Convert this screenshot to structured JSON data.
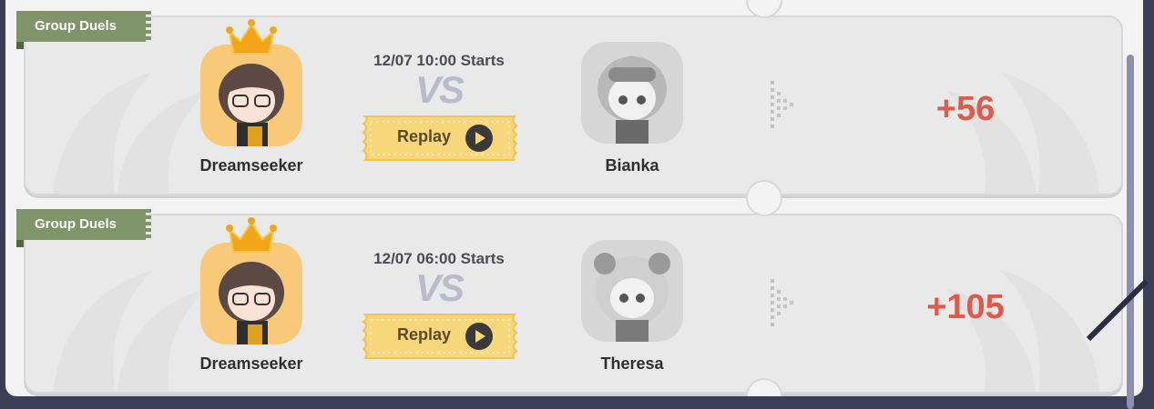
{
  "matches": [
    {
      "tag": "Group Duels",
      "player": "Dreamseeker",
      "time": "12/07 10:00 Starts",
      "vs": "VS",
      "replay_label": "Replay",
      "opponent": "Bianka",
      "score": "+56"
    },
    {
      "tag": "Group Duels",
      "player": "Dreamseeker",
      "time": "12/07 06:00 Starts",
      "vs": "VS",
      "replay_label": "Replay",
      "opponent": "Theresa",
      "score": "+105"
    }
  ],
  "colors": {
    "tag": "#7f9468",
    "score": "#e05a4c",
    "replay": "#f7d77a",
    "avatar_player": "#f9c97a",
    "crown": "#f2a516"
  },
  "icons": [
    "crown-icon",
    "play-icon",
    "arrow-right-icon"
  ]
}
